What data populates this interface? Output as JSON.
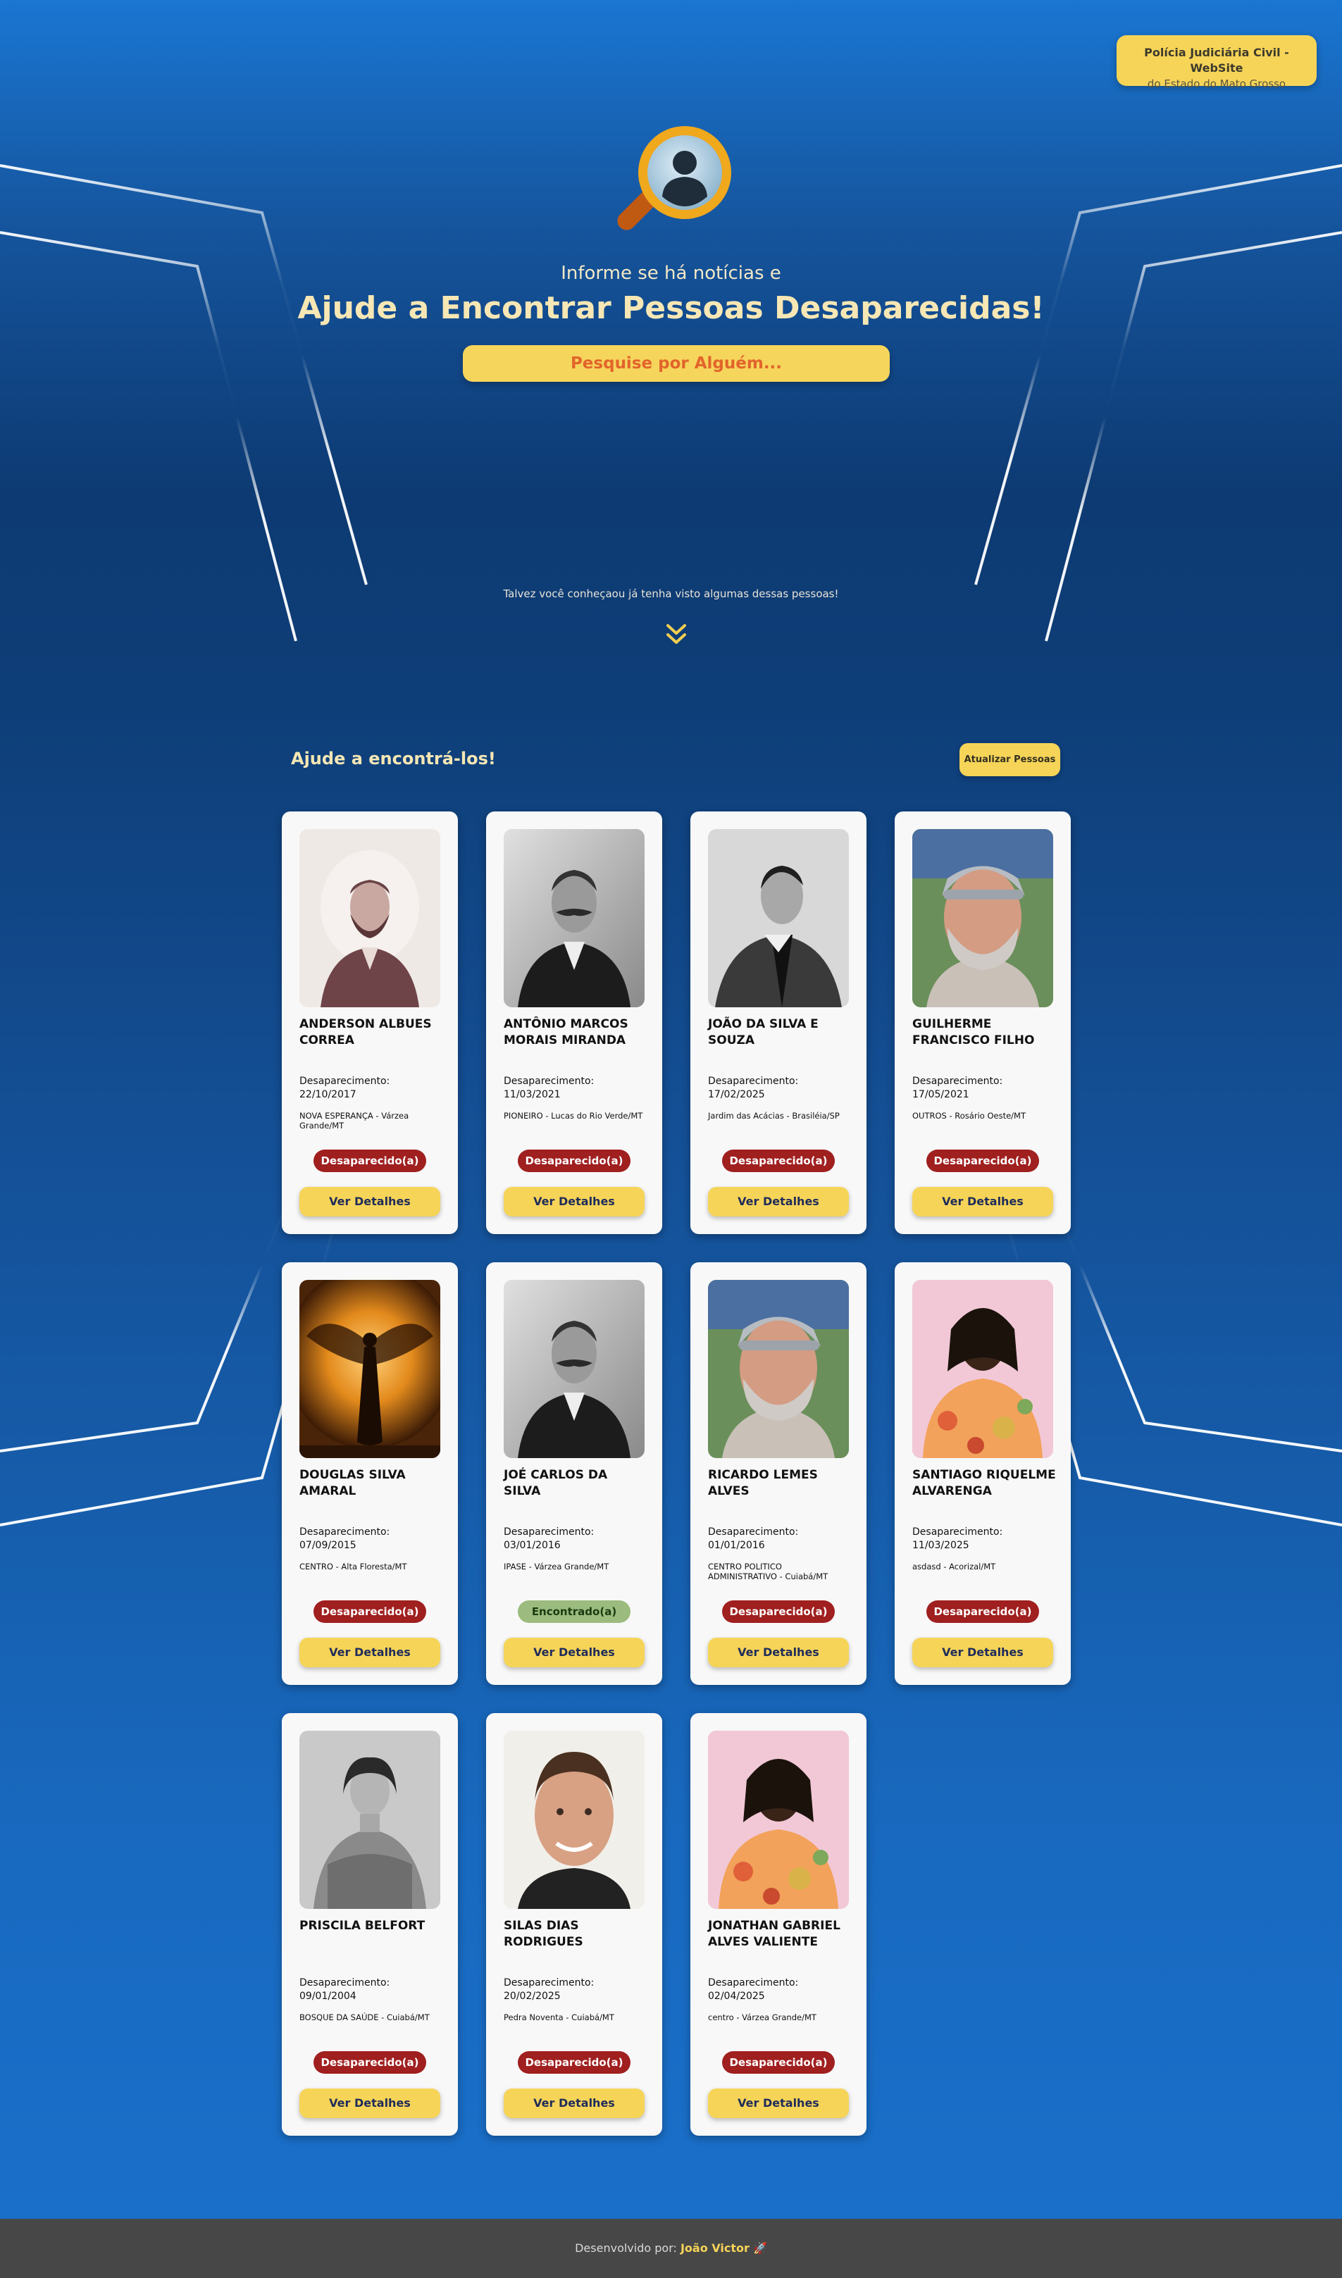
{
  "header": {
    "site_button_line1": "Polícia Judiciária Civil - WebSite",
    "site_button_line2": "do Estado do Mato Grosso"
  },
  "hero": {
    "subtitle": "Informe se há notícias e",
    "title": "Ajude a Encontrar Pessoas Desaparecidas!",
    "search_label": "Pesquise por Alguém...",
    "maybe_text": "Talvez você conheçaou já tenha visto algumas dessas pessoas!"
  },
  "section": {
    "title": "Ajude a encontrá-los!",
    "refresh_label": "Atualizar Pessoas"
  },
  "card_labels": {
    "disappeared_label": "Desaparecimento:",
    "details_label": "Ver Detalhes"
  },
  "people": [
    {
      "name": "ANDERSON ALBUES CORREA",
      "date": "22/10/2017",
      "location": "NOVA ESPERANÇA - Várzea Grande/MT",
      "status": "Desaparecido(a)",
      "photo": "vintage-man-portrait"
    },
    {
      "name": "ANTÔNIO MARCOS MORAIS MIRANDA",
      "date": "11/03/2021",
      "location": "PIONEIRO - Lucas do Rio Verde/MT",
      "status": "Desaparecido(a)",
      "photo": "bw-mustache-man"
    },
    {
      "name": "JOÃO DA SILVA E SOUZA",
      "date": "17/02/2025",
      "location": "Jardim das Acácias - Brasiléia/SP",
      "status": "Desaparecido(a)",
      "photo": "bw-profile-man"
    },
    {
      "name": "GUILHERME FRANCISCO FILHO",
      "date": "17/05/2021",
      "location": "OUTROS - Rosário Oeste/MT",
      "status": "Desaparecido(a)",
      "photo": "man-grey-cap"
    },
    {
      "name": "DOUGLAS SILVA AMARAL",
      "date": "07/09/2015",
      "location": "CENTRO - Alta Floresta/MT",
      "status": "Desaparecido(a)",
      "photo": "angel-silhouette"
    },
    {
      "name": "JOÉ CARLOS DA SILVA",
      "date": "03/01/2016",
      "location": "IPASE - Várzea Grande/MT",
      "status": "Encontrado(a)",
      "photo": "bw-mustache-man"
    },
    {
      "name": "RICARDO LEMES ALVES",
      "date": "01/01/2016",
      "location": "CENTRO POLITICO ADMINISTRATIVO - Cuiabá/MT",
      "status": "Desaparecido(a)",
      "photo": "man-grey-cap"
    },
    {
      "name": "SANTIAGO RIQUELME ALVARENGA",
      "date": "11/03/2025",
      "location": "asdasd - Acorizal/MT",
      "status": "Desaparecido(a)",
      "photo": "floral-dress-person"
    },
    {
      "name": "PRISCILA BELFORT",
      "date": "09/01/2004",
      "location": "BOSQUE DA SAÚDE - Cuiabá/MT",
      "status": "Desaparecido(a)",
      "photo": "vintage-woman-portrait"
    },
    {
      "name": "SILAS DIAS RODRIGUES",
      "date": "20/02/2025",
      "location": "Pedra Noventa - Cuiabá/MT",
      "status": "Desaparecido(a)",
      "photo": "smiling-man"
    },
    {
      "name": "JONATHAN GABRIEL ALVES VALIENTE",
      "date": "02/04/2025",
      "location": "centro - Várzea Grande/MT",
      "status": "Desaparecido(a)",
      "photo": "floral-dress-person"
    }
  ],
  "footer": {
    "prefix": "Desenvolvido por:",
    "author": "João Victor",
    "emoji": "🚀"
  }
}
